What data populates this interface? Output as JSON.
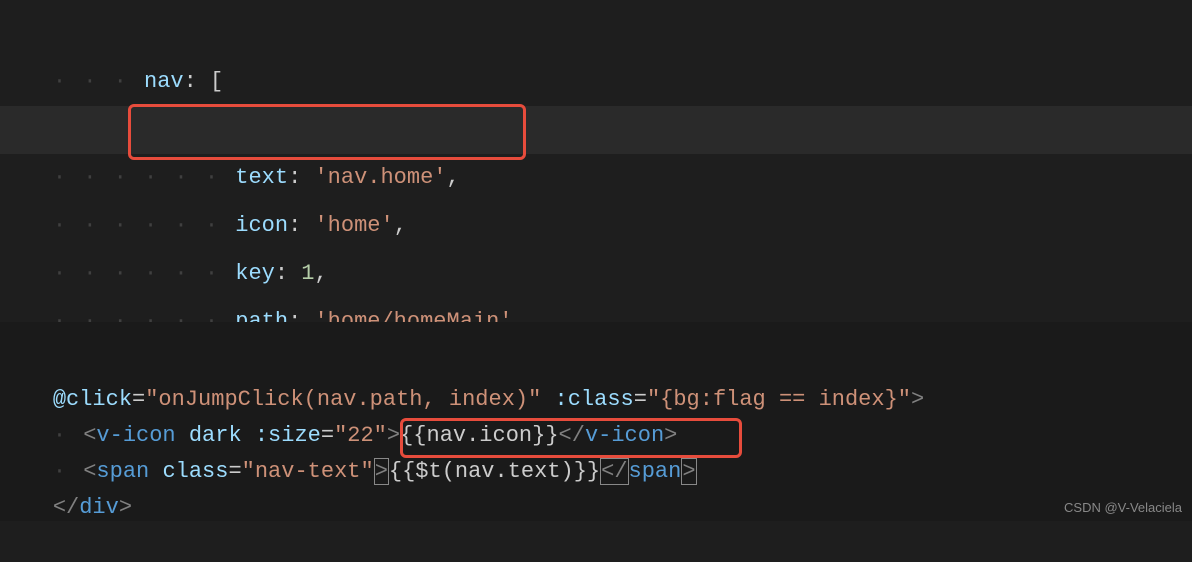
{
  "top_code": {
    "line1": {
      "indent": "· · · ",
      "key": "nav",
      "colon": ": ",
      "bracket": "["
    },
    "line2": {
      "indent": "· · · · · ",
      "brace": "{"
    },
    "line3": {
      "indent": "· · · · · · ",
      "key": "text",
      "colon": ": ",
      "value": "'nav.home'",
      "comma": ","
    },
    "line4": {
      "indent": "· · · · · · ",
      "key": "icon",
      "colon": ": ",
      "value": "'home'",
      "comma": ","
    },
    "line5": {
      "indent": "· · · · · · ",
      "key": "key",
      "colon": ": ",
      "value": "1",
      "comma": ","
    },
    "line6": {
      "indent": "· · · · · · ",
      "key": "path",
      "colon": ": ",
      "value": "'home/homeMain'"
    }
  },
  "bottom_code": {
    "line1": {
      "at": "@",
      "click": "click",
      "eq": "=",
      "handler": "\"onJumpClick(nav.path, index)\"",
      "space": " ",
      "colon_attr": ":class",
      "eq2": "=",
      "class_val": "\"{bg:flag == index}\"",
      "close": ">"
    },
    "line2": {
      "indent": "· ",
      "open": "<",
      "tag": "v-icon",
      "sp1": " ",
      "attr1": "dark",
      "sp2": " ",
      "attr2": ":size",
      "eq": "=",
      "val": "\"22\"",
      "gt": ">",
      "mustache": "{{nav.icon}}",
      "close_open": "</",
      "close_tag": "v-icon",
      "close_gt": ">"
    },
    "line3": {
      "indent": "· ",
      "open": "<",
      "tag": "span",
      "sp": " ",
      "attr": "class",
      "eq": "=",
      "val": "\"nav-text\"",
      "gt": ">",
      "mustache": "{{$t(nav.text)}}",
      "close_open": "</",
      "close_tag": "span",
      "close_gt": ">"
    },
    "line4": {
      "close_open": "</",
      "tag": "div",
      "gt": ">"
    }
  },
  "watermark": "CSDN @V-Velaciela"
}
